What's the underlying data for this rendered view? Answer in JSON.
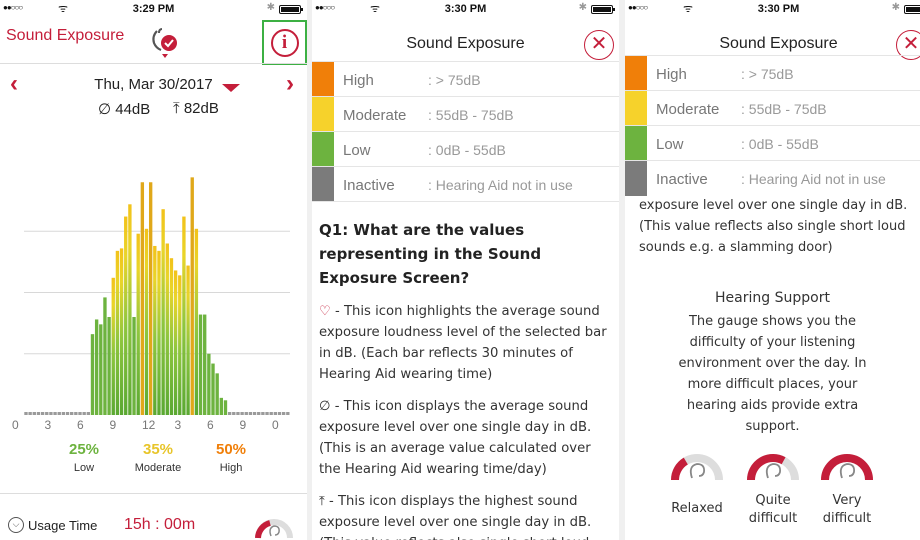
{
  "colors": {
    "brand_red": "#c41e3a",
    "high": "#f07f09",
    "moderate": "#f6d22b",
    "low": "#6db33f",
    "inactive": "#7b7b7b",
    "highlight": "#3cb043"
  },
  "screen1": {
    "status": {
      "time": "3:29 PM"
    },
    "title": "Sound Exposure",
    "date": "Thu, Mar 30/2017",
    "avg": "44dB",
    "max": "82dB",
    "axis_ticks": [
      "0",
      "3",
      "6",
      "9",
      "12",
      "3",
      "6",
      "9",
      "0"
    ],
    "percentages": [
      {
        "value": "25%",
        "label": "Low"
      },
      {
        "value": "35%",
        "label": "Moderate"
      },
      {
        "value": "50%",
        "label": "High"
      }
    ],
    "usage": {
      "label": "Usage Time",
      "value": "15h : 00m"
    }
  },
  "chart_data": {
    "type": "bar",
    "title": "",
    "xlabel": "",
    "ylabel": "",
    "x_tick_labels": [
      "0",
      "3",
      "6",
      "9",
      "12",
      "3",
      "6",
      "9",
      "0"
    ],
    "ylim": [
      0,
      100
    ],
    "values": [
      2,
      2,
      2,
      2,
      2,
      2,
      2,
      2,
      2,
      2,
      2,
      2,
      2,
      2,
      2,
      0,
      33,
      39,
      37,
      48,
      40,
      56,
      67,
      68,
      81,
      86,
      40,
      74,
      95,
      76,
      95,
      69,
      67,
      84,
      70,
      64,
      59,
      57,
      81,
      61,
      97,
      76,
      41,
      41,
      25,
      21,
      17,
      7,
      6,
      2,
      2,
      2,
      2,
      2,
      2,
      2,
      2,
      2,
      2,
      2,
      2,
      2,
      2,
      2
    ],
    "notes": "Half-hour bars over the day; bars colored in green-to-yellow/orange gradient by loudness; gray bars = inactive. Horizontal gridlines at 25/50/75."
  },
  "screen2": {
    "status": {
      "time": "3:30 PM"
    },
    "title": "Sound Exposure",
    "legend": [
      {
        "name": "High",
        "range": ": > 75dB"
      },
      {
        "name": "Moderate",
        "range": ": 55dB - 75dB"
      },
      {
        "name": "Low",
        "range": ": 0dB - 55dB"
      },
      {
        "name": "Inactive",
        "range": ": Hearing Aid not in use"
      }
    ],
    "q1": "Q1: What are the values representing in the Sound Exposure Screen?",
    "p1": " - This icon highlights the average sound exposure loudness level of the selected bar in dB. (Each bar reflects 30 minutes of Hearing Aid wearing time)",
    "p2": " - This icon displays the average sound exposure level over one single day in dB. (This is an average value calculated over the Hearing Aid wearing time/day)",
    "p3": " - This icon displays the highest sound exposure level over one single day in dB. (This value reflects also single short loud",
    "icon_avg": "∅",
    "icon_max": "⤒",
    "icon_pin": "♡"
  },
  "screen3": {
    "status": {
      "time": "3:30 PM"
    },
    "title": "Sound Exposure",
    "legend": [
      {
        "name": "High",
        "range": ": > 75dB"
      },
      {
        "name": "Moderate",
        "range": ": 55dB - 75dB"
      },
      {
        "name": "Low",
        "range": ": 0dB - 55dB"
      },
      {
        "name": "Inactive",
        "range": ": Hearing Aid not in use"
      }
    ],
    "scrolled_text": "exposure level over one single day in dB. (This value reflects also single short loud sounds e.g. a slamming door)",
    "support_title": "Hearing Support",
    "support_desc": "The gauge shows you the difficulty of your listening environment over the day. In more difficult places, your hearing aids provide extra support.",
    "gauges": [
      {
        "label": "Relaxed",
        "level": 0.33
      },
      {
        "label": "Quite difficult",
        "level": 0.66
      },
      {
        "label": "Very difficult",
        "level": 1.0
      }
    ]
  }
}
